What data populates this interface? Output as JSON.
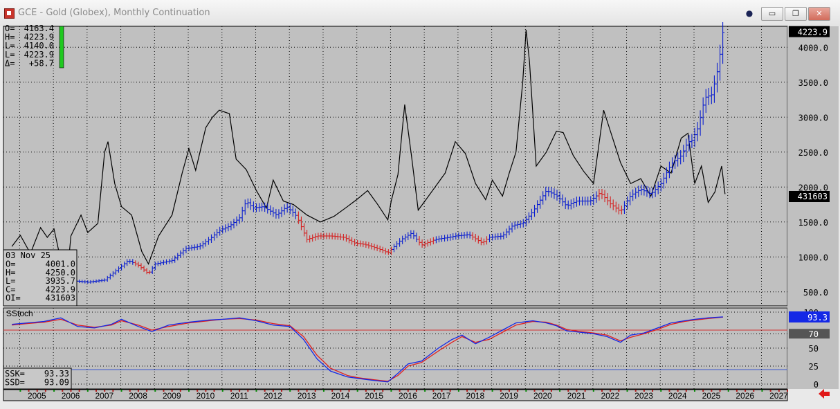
{
  "window": {
    "title": "GCE - Gold (Globex), Monthly Continuation",
    "controls": {
      "pin": "●",
      "minimize": "▭",
      "restore": "❐",
      "close": "✕"
    }
  },
  "colors": {
    "background": "#c0c0c0",
    "price_up": "#0a1ecf",
    "price_down": "#d42020",
    "open_interest": "#000000",
    "stoch_k": "#1428e6",
    "stoch_d": "#e02020",
    "readout_badge": "#1428e6"
  },
  "readout_top": {
    "rows": [
      {
        "label": "O=",
        "value": "4163.4"
      },
      {
        "label": "H=",
        "value": "4223.9"
      },
      {
        "label": "L=",
        "value": "4140.0"
      },
      {
        "label": "L=",
        "value": "4223.9"
      },
      {
        "label": "Δ=",
        "value": "+58.7"
      }
    ]
  },
  "readout_bottom": {
    "date": "03 Nov 25",
    "rows": [
      {
        "label": "O=",
        "value": "4001.0"
      },
      {
        "label": "H=",
        "value": "4250.0"
      },
      {
        "label": "L=",
        "value": "3935.7"
      },
      {
        "label": "C=",
        "value": "4223.9"
      },
      {
        "label": "OI=",
        "value": "431603"
      }
    ]
  },
  "stoch_readout": {
    "rows": [
      {
        "label": "SSK=",
        "value": "93.33"
      },
      {
        "label": "SSD=",
        "value": "93.09"
      }
    ]
  },
  "chart_data": [
    {
      "type": "bar",
      "title": "GCE - Gold (Globex), Monthly Continuation",
      "price_ylim": [
        300,
        4300
      ],
      "price_ticks": [
        "500.0",
        "1000.0",
        "1500.0",
        "2000.0",
        "2500.0",
        "3000.0",
        "3500.0",
        "4000.0"
      ],
      "last_price_label": "4223.9",
      "oi_last_label": "431603",
      "x_ticks": [
        "2005",
        "2006",
        "2007",
        "2008",
        "2009",
        "2010",
        "2011",
        "2012",
        "2013",
        "2014",
        "2015",
        "2016",
        "2017",
        "2018",
        "2019",
        "2020",
        "2021",
        "2022",
        "2023",
        "2024",
        "2025",
        "2026",
        "2027"
      ],
      "price_series": [
        [
          2006.0,
          600
        ],
        [
          2006.5,
          660
        ],
        [
          2007.0,
          640
        ],
        [
          2007.5,
          670
        ],
        [
          2007.9,
          830
        ],
        [
          2008.2,
          950
        ],
        [
          2008.5,
          880
        ],
        [
          2008.8,
          760
        ],
        [
          2009.0,
          900
        ],
        [
          2009.5,
          950
        ],
        [
          2009.9,
          1120
        ],
        [
          2010.3,
          1150
        ],
        [
          2010.6,
          1250
        ],
        [
          2010.9,
          1380
        ],
        [
          2011.2,
          1440
        ],
        [
          2011.5,
          1560
        ],
        [
          2011.7,
          1800
        ],
        [
          2011.9,
          1700
        ],
        [
          2012.2,
          1720
        ],
        [
          2012.6,
          1600
        ],
        [
          2012.9,
          1720
        ],
        [
          2013.2,
          1580
        ],
        [
          2013.5,
          1250
        ],
        [
          2013.8,
          1300
        ],
        [
          2014.2,
          1300
        ],
        [
          2014.6,
          1280
        ],
        [
          2014.9,
          1200
        ],
        [
          2015.2,
          1180
        ],
        [
          2015.6,
          1120
        ],
        [
          2015.9,
          1060
        ],
        [
          2016.3,
          1250
        ],
        [
          2016.6,
          1340
        ],
        [
          2016.9,
          1170
        ],
        [
          2017.3,
          1250
        ],
        [
          2017.7,
          1280
        ],
        [
          2017.9,
          1300
        ],
        [
          2018.3,
          1320
        ],
        [
          2018.7,
          1200
        ],
        [
          2018.9,
          1280
        ],
        [
          2019.3,
          1300
        ],
        [
          2019.6,
          1450
        ],
        [
          2019.9,
          1480
        ],
        [
          2020.2,
          1650
        ],
        [
          2020.6,
          1950
        ],
        [
          2020.9,
          1880
        ],
        [
          2021.2,
          1730
        ],
        [
          2021.5,
          1800
        ],
        [
          2021.9,
          1800
        ],
        [
          2022.2,
          1920
        ],
        [
          2022.5,
          1760
        ],
        [
          2022.8,
          1650
        ],
        [
          2023.1,
          1880
        ],
        [
          2023.4,
          1970
        ],
        [
          2023.7,
          1900
        ],
        [
          2024.0,
          2050
        ],
        [
          2024.3,
          2330
        ],
        [
          2024.6,
          2450
        ],
        [
          2024.8,
          2650
        ],
        [
          2024.9,
          2650
        ],
        [
          2025.1,
          2850
        ],
        [
          2025.3,
          3280
        ],
        [
          2025.5,
          3320
        ],
        [
          2025.65,
          3600
        ],
        [
          2025.75,
          3900
        ],
        [
          2025.8,
          4150
        ],
        [
          2025.84,
          4223.9
        ]
      ],
      "down_segments": [
        [
          2008.35,
          2008.85
        ],
        [
          2013.2,
          2016.0
        ],
        [
          2016.75,
          2017.3
        ],
        [
          2018.4,
          2018.9
        ],
        [
          2022.15,
          2022.9
        ]
      ],
      "open_interest": [
        [
          2004.75,
          1150
        ],
        [
          2005.0,
          1310
        ],
        [
          2005.3,
          1050
        ],
        [
          2005.6,
          1420
        ],
        [
          2005.8,
          1280
        ],
        [
          2006.0,
          1400
        ],
        [
          2006.2,
          950
        ],
        [
          2006.35,
          520
        ],
        [
          2006.5,
          1300
        ],
        [
          2006.8,
          1600
        ],
        [
          2007.0,
          1350
        ],
        [
          2007.3,
          1480
        ],
        [
          2007.5,
          2500
        ],
        [
          2007.6,
          2650
        ],
        [
          2007.8,
          2050
        ],
        [
          2008.0,
          1720
        ],
        [
          2008.3,
          1600
        ],
        [
          2008.6,
          1080
        ],
        [
          2008.8,
          900
        ],
        [
          2009.1,
          1300
        ],
        [
          2009.5,
          1600
        ],
        [
          2009.8,
          2200
        ],
        [
          2010.0,
          2550
        ],
        [
          2010.2,
          2240
        ],
        [
          2010.5,
          2850
        ],
        [
          2010.7,
          3000
        ],
        [
          2010.9,
          3100
        ],
        [
          2011.2,
          3050
        ],
        [
          2011.4,
          2400
        ],
        [
          2011.7,
          2250
        ],
        [
          2012.0,
          1950
        ],
        [
          2012.3,
          1700
        ],
        [
          2012.5,
          2100
        ],
        [
          2012.8,
          1800
        ],
        [
          2013.1,
          1750
        ],
        [
          2013.5,
          1600
        ],
        [
          2013.9,
          1500
        ],
        [
          2014.3,
          1580
        ],
        [
          2014.7,
          1720
        ],
        [
          2015.0,
          1830
        ],
        [
          2015.3,
          1950
        ],
        [
          2015.6,
          1750
        ],
        [
          2015.9,
          1530
        ],
        [
          2016.0,
          1800
        ],
        [
          2016.2,
          2180
        ],
        [
          2016.4,
          3180
        ],
        [
          2016.6,
          2450
        ],
        [
          2016.8,
          1670
        ],
        [
          2017.0,
          1800
        ],
        [
          2017.3,
          2000
        ],
        [
          2017.6,
          2200
        ],
        [
          2017.9,
          2650
        ],
        [
          2018.2,
          2480
        ],
        [
          2018.5,
          2050
        ],
        [
          2018.8,
          1820
        ],
        [
          2019.0,
          2100
        ],
        [
          2019.3,
          1870
        ],
        [
          2019.5,
          2200
        ],
        [
          2019.7,
          2500
        ],
        [
          2019.9,
          3500
        ],
        [
          2020.0,
          4250
        ],
        [
          2020.1,
          3800
        ],
        [
          2020.3,
          2300
        ],
        [
          2020.6,
          2500
        ],
        [
          2020.9,
          2800
        ],
        [
          2021.1,
          2780
        ],
        [
          2021.4,
          2450
        ],
        [
          2021.7,
          2230
        ],
        [
          2022.0,
          2050
        ],
        [
          2022.3,
          3100
        ],
        [
          2022.5,
          2800
        ],
        [
          2022.8,
          2350
        ],
        [
          2023.1,
          2050
        ],
        [
          2023.4,
          2120
        ],
        [
          2023.7,
          1870
        ],
        [
          2024.0,
          2300
        ],
        [
          2024.3,
          2200
        ],
        [
          2024.6,
          2700
        ],
        [
          2024.8,
          2770
        ],
        [
          2025.0,
          2050
        ],
        [
          2025.2,
          2300
        ],
        [
          2025.4,
          1780
        ],
        [
          2025.6,
          1930
        ],
        [
          2025.8,
          2300
        ],
        [
          2025.9,
          1900
        ]
      ]
    },
    {
      "type": "line",
      "title": "SStoch",
      "ylim": [
        0,
        100
      ],
      "y_ticks": [
        "0",
        "25",
        "50",
        "70",
        "75",
        "100"
      ],
      "ref_lines": [
        75,
        70,
        20
      ],
      "k_label": "93.3",
      "d_label": "70",
      "series": [
        {
          "name": "SSK",
          "values": [
            [
              2004.75,
              83
            ],
            [
              2005.2,
              85
            ],
            [
              2005.7,
              87
            ],
            [
              2006.2,
              92
            ],
            [
              2006.7,
              80
            ],
            [
              2007.2,
              78
            ],
            [
              2007.7,
              83
            ],
            [
              2008.0,
              90
            ],
            [
              2008.5,
              80
            ],
            [
              2008.9,
              73
            ],
            [
              2009.4,
              82
            ],
            [
              2010.0,
              86
            ],
            [
              2010.6,
              89
            ],
            [
              2011.0,
              90
            ],
            [
              2011.5,
              92
            ],
            [
              2012.0,
              88
            ],
            [
              2012.5,
              82
            ],
            [
              2013.0,
              80
            ],
            [
              2013.4,
              62
            ],
            [
              2013.8,
              35
            ],
            [
              2014.2,
              18
            ],
            [
              2014.7,
              10
            ],
            [
              2015.0,
              8
            ],
            [
              2015.5,
              5
            ],
            [
              2015.9,
              3
            ],
            [
              2016.2,
              15
            ],
            [
              2016.5,
              28
            ],
            [
              2016.9,
              32
            ],
            [
              2017.4,
              50
            ],
            [
              2017.8,
              62
            ],
            [
              2018.1,
              68
            ],
            [
              2018.5,
              56
            ],
            [
              2018.9,
              65
            ],
            [
              2019.3,
              75
            ],
            [
              2019.7,
              85
            ],
            [
              2020.2,
              88
            ],
            [
              2020.6,
              85
            ],
            [
              2020.9,
              81
            ],
            [
              2021.2,
              74
            ],
            [
              2021.6,
              72
            ],
            [
              2022.0,
              70
            ],
            [
              2022.4,
              66
            ],
            [
              2022.8,
              58
            ],
            [
              2023.1,
              68
            ],
            [
              2023.5,
              71
            ],
            [
              2023.9,
              78
            ],
            [
              2024.3,
              85
            ],
            [
              2024.7,
              88
            ],
            [
              2025.0,
              90
            ],
            [
              2025.4,
              92
            ],
            [
              2025.84,
              93.33
            ]
          ]
        },
        {
          "name": "SSD",
          "values": [
            [
              2004.75,
              82
            ],
            [
              2005.2,
              84
            ],
            [
              2005.7,
              86
            ],
            [
              2006.2,
              90
            ],
            [
              2006.7,
              82
            ],
            [
              2007.2,
              79
            ],
            [
              2007.7,
              82
            ],
            [
              2008.0,
              88
            ],
            [
              2008.5,
              82
            ],
            [
              2008.9,
              75
            ],
            [
              2009.4,
              80
            ],
            [
              2010.0,
              85
            ],
            [
              2010.6,
              88
            ],
            [
              2011.0,
              90
            ],
            [
              2011.5,
              91
            ],
            [
              2012.0,
              89
            ],
            [
              2012.5,
              84
            ],
            [
              2013.0,
              81
            ],
            [
              2013.4,
              66
            ],
            [
              2013.8,
              40
            ],
            [
              2014.2,
              22
            ],
            [
              2014.7,
              12
            ],
            [
              2015.0,
              9
            ],
            [
              2015.5,
              6
            ],
            [
              2015.9,
              4
            ],
            [
              2016.2,
              12
            ],
            [
              2016.5,
              25
            ],
            [
              2016.9,
              30
            ],
            [
              2017.4,
              46
            ],
            [
              2017.8,
              58
            ],
            [
              2018.1,
              66
            ],
            [
              2018.5,
              58
            ],
            [
              2018.9,
              62
            ],
            [
              2019.3,
              72
            ],
            [
              2019.7,
              82
            ],
            [
              2020.2,
              87
            ],
            [
              2020.6,
              86
            ],
            [
              2020.9,
              82
            ],
            [
              2021.2,
              76
            ],
            [
              2021.6,
              73
            ],
            [
              2022.0,
              71
            ],
            [
              2022.4,
              68
            ],
            [
              2022.8,
              60
            ],
            [
              2023.1,
              65
            ],
            [
              2023.5,
              70
            ],
            [
              2023.9,
              76
            ],
            [
              2024.3,
              83
            ],
            [
              2024.7,
              87
            ],
            [
              2025.0,
              89
            ],
            [
              2025.4,
              91
            ],
            [
              2025.84,
              93.09
            ]
          ]
        }
      ]
    }
  ]
}
